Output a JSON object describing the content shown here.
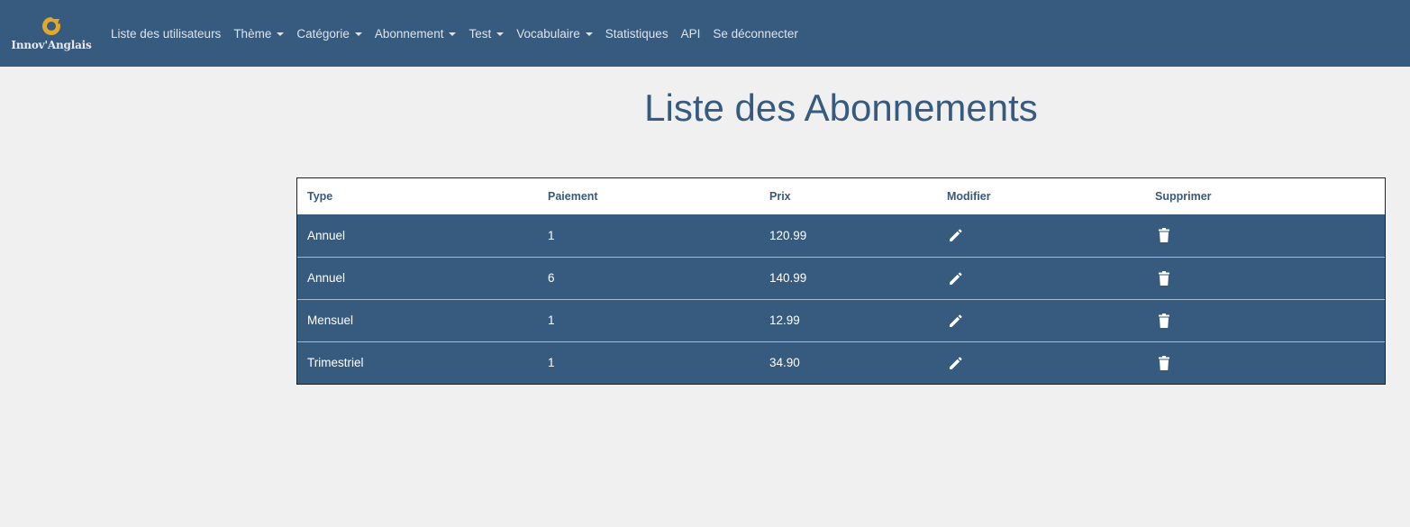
{
  "brand": {
    "name": "Innov'Anglais"
  },
  "nav": [
    {
      "label": "Liste des utilisateurs",
      "dropdown": false
    },
    {
      "label": "Thème",
      "dropdown": true
    },
    {
      "label": "Catégorie",
      "dropdown": true
    },
    {
      "label": "Abonnement",
      "dropdown": true
    },
    {
      "label": "Test",
      "dropdown": true
    },
    {
      "label": "Vocabulaire",
      "dropdown": true
    },
    {
      "label": "Statistiques",
      "dropdown": false
    },
    {
      "label": "API",
      "dropdown": false
    },
    {
      "label": "Se déconnecter",
      "dropdown": false
    }
  ],
  "page": {
    "title": "Liste des Abonnements"
  },
  "table": {
    "headers": [
      "Type",
      "Paiement",
      "Prix",
      "Modifier",
      "Supprimer"
    ],
    "rows": [
      {
        "type": "Annuel",
        "paiement": "1",
        "prix": "120.99",
        "edit_icon": "pencil-icon",
        "delete_icon": "trash-icon"
      },
      {
        "type": "Annuel",
        "paiement": "6",
        "prix": "140.99",
        "edit_icon": "pencil-icon",
        "delete_icon": "trash-icon"
      },
      {
        "type": "Mensuel",
        "paiement": "1",
        "prix": "12.99",
        "edit_icon": "pencil-icon",
        "delete_icon": "trash-icon"
      },
      {
        "type": "Trimestriel",
        "paiement": "1",
        "prix": "34.90",
        "edit_icon": "pencil-icon",
        "delete_icon": "trash-icon"
      }
    ]
  },
  "colors": {
    "primary": "#375a7f",
    "background": "#f0f0f0",
    "logo_accent": "#e0a82e"
  }
}
